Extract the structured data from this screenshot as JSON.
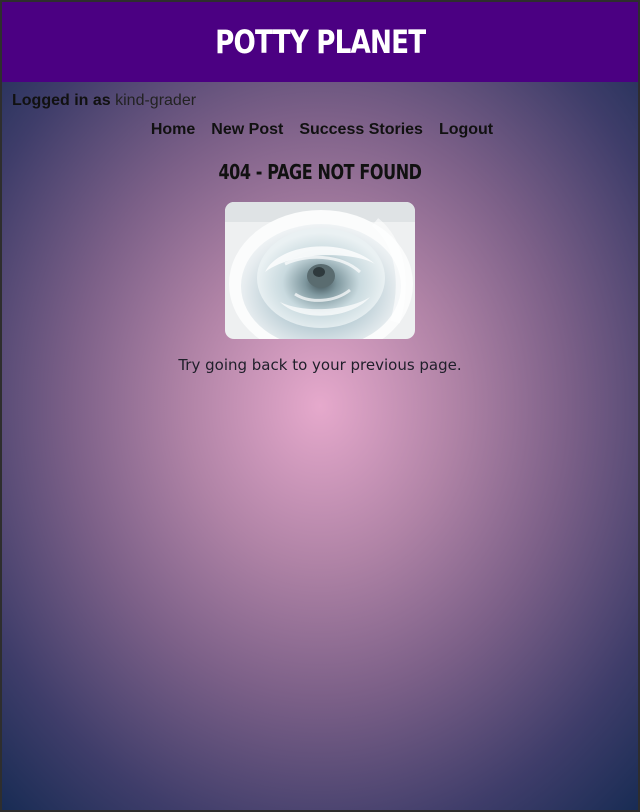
{
  "header": {
    "title": "POTTY PLANET"
  },
  "login": {
    "label": "Logged in as",
    "username": "kind-grader"
  },
  "nav": {
    "items": [
      {
        "label": "Home"
      },
      {
        "label": "New Post"
      },
      {
        "label": "Success Stories"
      },
      {
        "label": "Logout"
      }
    ]
  },
  "main": {
    "heading": "404 - PAGE NOT FOUND",
    "message": "Try going back to your previous page."
  },
  "colors": {
    "header_bg": "#4b0082",
    "background_center": "#e6a9cc",
    "background_edge": "#142a52"
  },
  "icons": {
    "image": "flushing-toilet-image"
  }
}
